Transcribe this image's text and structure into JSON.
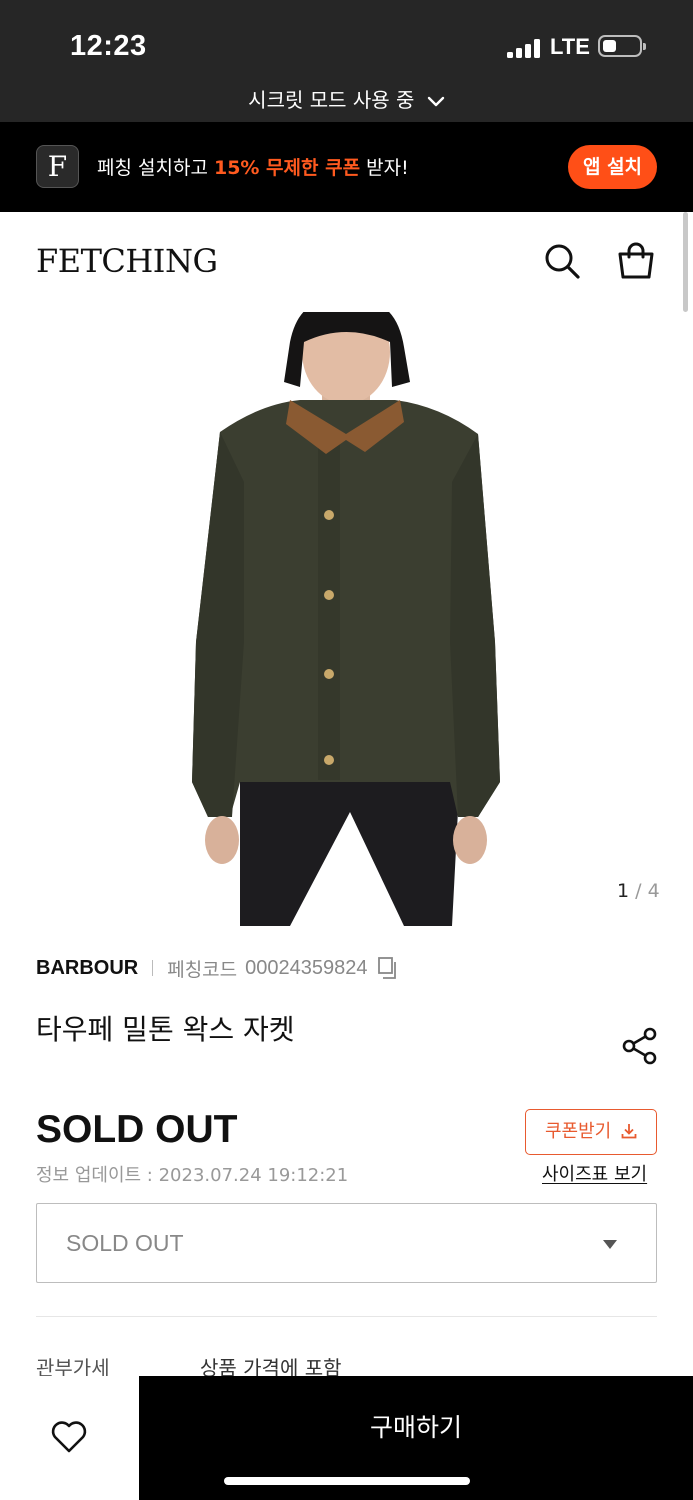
{
  "status_bar": {
    "time": "12:23",
    "network": "LTE",
    "battery_level_pct": 30,
    "secret_mode_label": "시크릿 모드 사용 중"
  },
  "app_banner": {
    "logo_letter": "F",
    "text_before": "페칭 설치하고 ",
    "text_highlight": "15% 무제한 쿠폰",
    "text_after": " 받자!",
    "install_label": "앱 설치",
    "accent_color": "#ff4f17"
  },
  "header": {
    "logo": "FETCHING",
    "icons": [
      "search-icon",
      "shopping-bag-icon"
    ]
  },
  "gallery": {
    "current": "1",
    "total": "4",
    "separator": "/"
  },
  "product": {
    "brand": "BARBOUR",
    "code_label": "페칭코드",
    "code": "00024359824",
    "title": "타우페 밀톤 왁스 자켓",
    "price": "SOLD OUT",
    "coupon_label": "쿠폰받기",
    "updated": "정보 업데이트 : 2023.07.24 19:12:21",
    "size_chart_label": "사이즈표 보기",
    "option_selected": "SOLD OUT",
    "duty_label": "관부가세",
    "duty_value": "상품 가격에 포함"
  },
  "bottom_bar": {
    "buy_label": "구매하기",
    "icons": [
      "heart-icon"
    ]
  }
}
